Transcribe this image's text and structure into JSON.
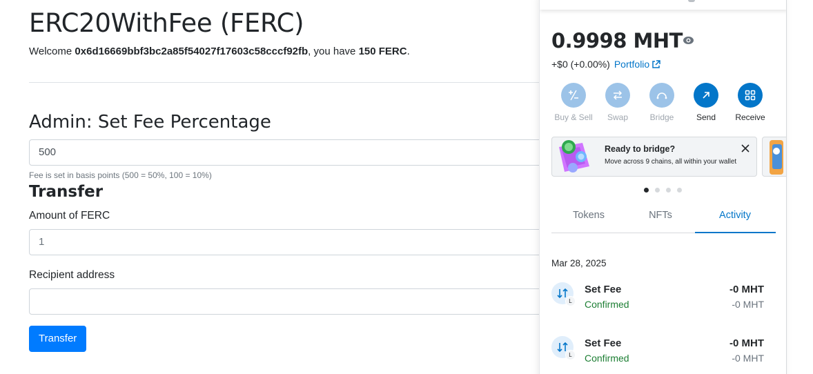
{
  "dapp": {
    "title": "ERC20WithFee (FERC)",
    "welcome_prefix": "Welcome ",
    "account": "0x6d16669bbf3bc2a85f54027f17603c58cccf92fb",
    "welcome_middle": ", you have ",
    "balance": "150 FERC",
    "welcome_suffix": ".",
    "admin_heading": "Admin: Set Fee Percentage",
    "fee_value": "500",
    "fee_help": "Fee is set in basis points (500 = 50%, 100 = 10%)",
    "transfer_heading": "Transfer",
    "amount_label": "Amount of FERC",
    "amount_value": "1",
    "recipient_label": "Recipient address",
    "recipient_value": "",
    "transfer_button": "Transfer",
    "accent_color": "#007bff"
  },
  "wallet": {
    "balance": "0.9998",
    "currency": "MHT",
    "change": "+$0 (+0.00%)",
    "portfolio_link": "Portfolio",
    "actions": [
      {
        "label": "Buy & Sell",
        "icon": "plus-minus-icon",
        "enabled": false
      },
      {
        "label": "Swap",
        "icon": "swap-arrows-icon",
        "enabled": false
      },
      {
        "label": "Bridge",
        "icon": "bridge-icon",
        "enabled": false
      },
      {
        "label": "Send",
        "icon": "arrow-up-right-icon",
        "enabled": true
      },
      {
        "label": "Receive",
        "icon": "qr-code-icon",
        "enabled": true
      }
    ],
    "banner": {
      "title": "Ready to bridge?",
      "subtitle": "Move across 9 chains, all within your wallet"
    },
    "carousel_active_index": 0,
    "tabs": [
      "Tokens",
      "NFTs",
      "Activity"
    ],
    "active_tab": "Activity",
    "activity_date": "Mar 28, 2025",
    "transactions": [
      {
        "title": "Set Fee",
        "status": "Confirmed",
        "amount": "-0 MHT",
        "fiat": "-0 MHT",
        "badge": "L"
      },
      {
        "title": "Set Fee",
        "status": "Confirmed",
        "amount": "-0 MHT",
        "fiat": "-0 MHT",
        "badge": "L"
      }
    ],
    "colors": {
      "primary": "#0376c9",
      "primary_muted": "#9cc3e8",
      "success": "#1c7e33"
    }
  }
}
